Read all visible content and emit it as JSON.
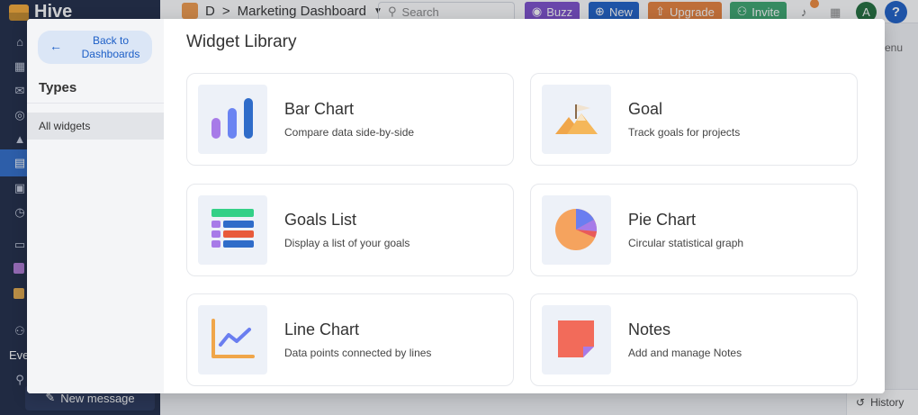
{
  "app": {
    "brand": "Hive",
    "user_initial": "A",
    "help": "?",
    "side_label_events": "Eve",
    "new_message": "New message",
    "menu_peek": "enu",
    "history": "History"
  },
  "topbar": {
    "workspace_initial": "D",
    "breadcrumb_sep": ">",
    "dashboard_title": "Marketing Dashboard",
    "search_placeholder": "Search",
    "buzz": "Buzz",
    "new": "New",
    "upgrade": "Upgrade",
    "invite": "Invite"
  },
  "colors": {
    "buzz": "#7c4dcc",
    "new": "#1d5fc7",
    "upgrade": "#e8813a",
    "invite": "#3aa66e"
  },
  "modal": {
    "back_label": "Back to\nDashboards",
    "types_title": "Types",
    "types": [
      "All widgets"
    ],
    "title": "Widget Library",
    "widgets": [
      {
        "title": "Bar Chart",
        "desc": "Compare data side-by-side",
        "icon": "bar-chart-icon"
      },
      {
        "title": "Goal",
        "desc": "Track goals for projects",
        "icon": "goal-mountain-icon"
      },
      {
        "title": "Goals List",
        "desc": "Display a list of your goals",
        "icon": "goals-list-icon"
      },
      {
        "title": "Pie Chart",
        "desc": "Circular statistical graph",
        "icon": "pie-chart-icon"
      },
      {
        "title": "Line Chart",
        "desc": "Data points connected by lines",
        "icon": "line-chart-icon"
      },
      {
        "title": "Notes",
        "desc": "Add and manage Notes",
        "icon": "note-icon"
      }
    ]
  }
}
